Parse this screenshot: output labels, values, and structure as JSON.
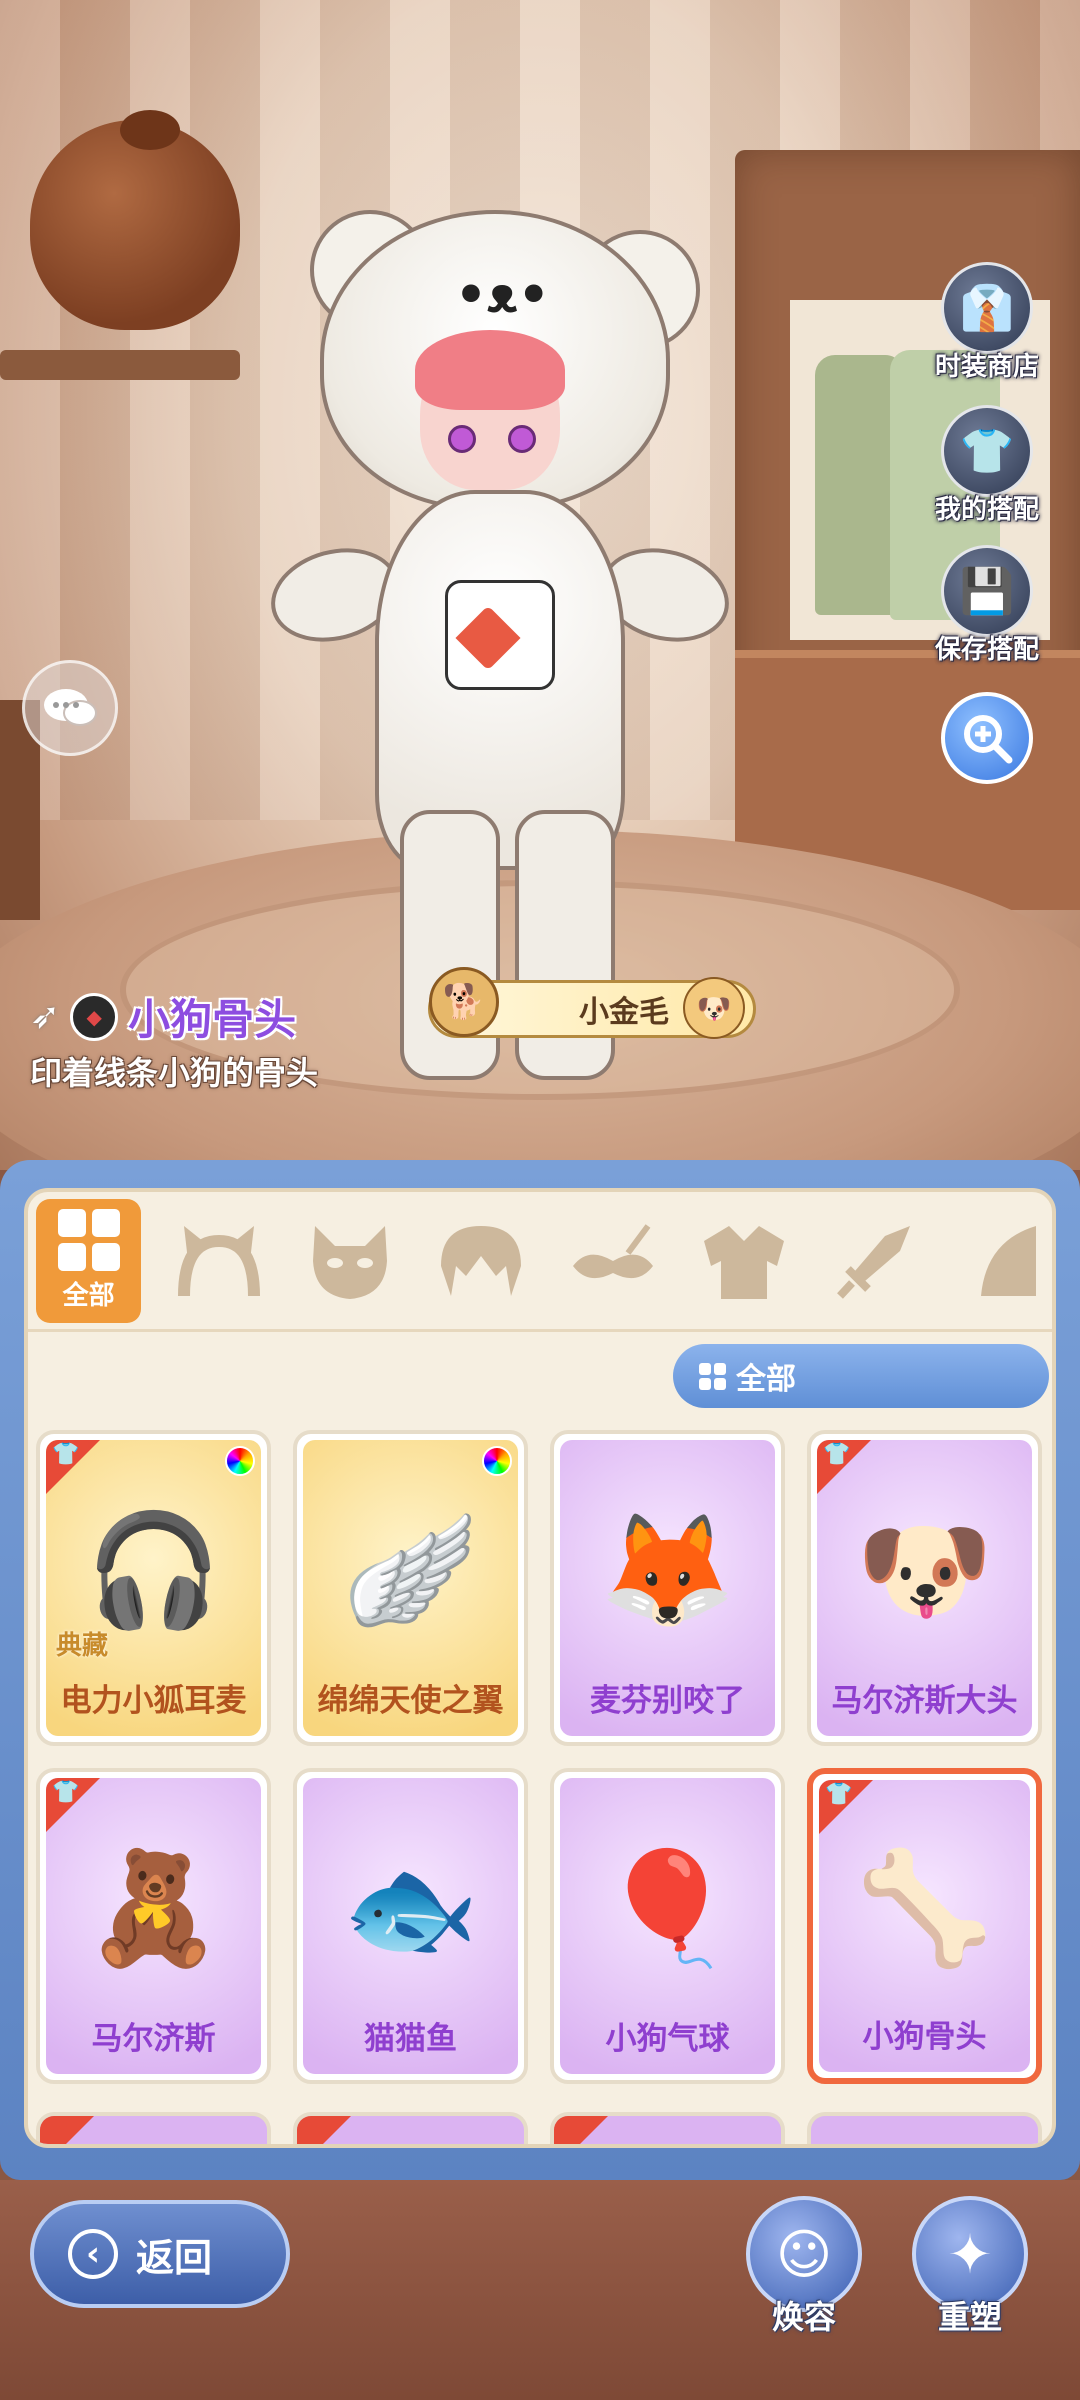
{
  "side_menu": {
    "shop": {
      "label": "时装商店",
      "icon": "shirt-store-icon"
    },
    "my_outfits": {
      "label": "我的搭配",
      "icon": "shirt-question-icon"
    },
    "save": {
      "label": "保存搭配",
      "icon": "save-disk-icon"
    }
  },
  "zoom": {
    "icon": "zoom-in-icon"
  },
  "chat": {
    "icon": "chat-bubble-icon"
  },
  "item_info": {
    "name": "小狗骨头",
    "description": "印着线条小狗的骨头",
    "brand": "◆"
  },
  "pet_tag": {
    "label": "小金毛"
  },
  "categories": {
    "active_label": "全部",
    "icons": [
      "cat-ear-headband-icon",
      "mask-icon",
      "hair-icon",
      "eye-mask-icon",
      "top-icon",
      "sword-icon",
      "cape-icon"
    ]
  },
  "filter": {
    "label": "全部"
  },
  "items": [
    {
      "label": "电力小狐耳麦",
      "rarity": "gold",
      "badge": "典藏",
      "tag": true,
      "color_variant": true,
      "art": "🎧"
    },
    {
      "label": "绵绵天使之翼",
      "rarity": "gold",
      "badge": "",
      "tag": false,
      "color_variant": true,
      "art": "🪽"
    },
    {
      "label": "麦芬别咬了",
      "rarity": "purple",
      "badge": "",
      "tag": false,
      "color_variant": false,
      "art": "🦊"
    },
    {
      "label": "马尔济斯大头",
      "rarity": "purple",
      "badge": "",
      "tag": true,
      "color_variant": false,
      "art": "🐶"
    },
    {
      "label": "马尔济斯",
      "rarity": "purple",
      "badge": "",
      "tag": true,
      "color_variant": false,
      "art": "🧸"
    },
    {
      "label": "猫猫鱼",
      "rarity": "purple",
      "badge": "",
      "tag": false,
      "color_variant": false,
      "art": "🐟"
    },
    {
      "label": "小狗气球",
      "rarity": "purple",
      "badge": "",
      "tag": false,
      "color_variant": false,
      "art": "🎈"
    },
    {
      "label": "小狗骨头",
      "rarity": "purple",
      "badge": "",
      "tag": true,
      "color_variant": false,
      "selected": true,
      "art": "🦴"
    }
  ],
  "bottom": {
    "back_label": "返回",
    "makeover_label": "焕容",
    "reshape_label": "重塑"
  },
  "colors": {
    "accent_orange": "#f09a3a",
    "panel_blue": "#6a8fcf",
    "selected_border": "#f0683e",
    "purple_text": "#8f3fcf",
    "gold_text": "#b2531e"
  }
}
